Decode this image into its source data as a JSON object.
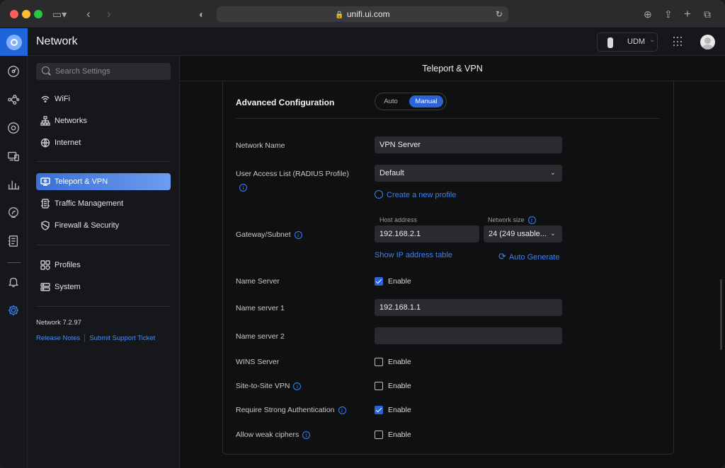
{
  "browser": {
    "url": "unifi.ui.com"
  },
  "app": {
    "title": "Network",
    "device": "UDM"
  },
  "sidebar": {
    "search_placeholder": "Search Settings",
    "items": [
      {
        "label": "WiFi",
        "icon": "wifi-icon"
      },
      {
        "label": "Networks",
        "icon": "networks-icon"
      },
      {
        "label": "Internet",
        "icon": "globe-icon"
      },
      {
        "label": "Teleport & VPN",
        "icon": "teleport-vpn-icon",
        "active": true
      },
      {
        "label": "Traffic Management",
        "icon": "traffic-management-icon"
      },
      {
        "label": "Firewall & Security",
        "icon": "shield-icon"
      },
      {
        "label": "Profiles",
        "icon": "profiles-icon"
      },
      {
        "label": "System",
        "icon": "system-icon"
      }
    ],
    "version": "Network 7.2.97",
    "release_notes": "Release Notes",
    "support_ticket": "Submit Support Ticket"
  },
  "main": {
    "header": "Teleport & VPN",
    "advanced": {
      "title": "Advanced Configuration",
      "mode_options": [
        "Auto",
        "Manual"
      ],
      "selected_mode": "Manual"
    },
    "fields": {
      "network_name": {
        "label": "Network Name",
        "value": "VPN Server"
      },
      "user_access": {
        "label": "User Access List (RADIUS Profile)",
        "value": "Default",
        "link": "Create a new profile"
      },
      "gateway": {
        "label": "Gateway/Subnet",
        "host_label": "Host address",
        "host_value": "192.168.2.1",
        "size_label": "Network size",
        "size_value": "24 (249 usable...",
        "show_table": "Show IP address table",
        "auto_generate": "Auto Generate"
      },
      "name_server": {
        "label": "Name Server",
        "enable": "Enable",
        "checked": true
      },
      "name_server_1": {
        "label": "Name server 1",
        "value": "192.168.1.1"
      },
      "name_server_2": {
        "label": "Name server 2",
        "value": ""
      },
      "wins_server": {
        "label": "WINS Server",
        "enable": "Enable",
        "checked": false
      },
      "site_to_site": {
        "label": "Site-to-Site VPN",
        "enable": "Enable",
        "checked": false
      },
      "strong_auth": {
        "label": "Require Strong Authentication",
        "enable": "Enable",
        "checked": true
      },
      "weak_ciphers": {
        "label": "Allow weak ciphers",
        "enable": "Enable",
        "checked": false
      }
    }
  },
  "colors": {
    "accent": "#2c63d9",
    "link": "#3b82f6",
    "background": "#0f1012"
  }
}
